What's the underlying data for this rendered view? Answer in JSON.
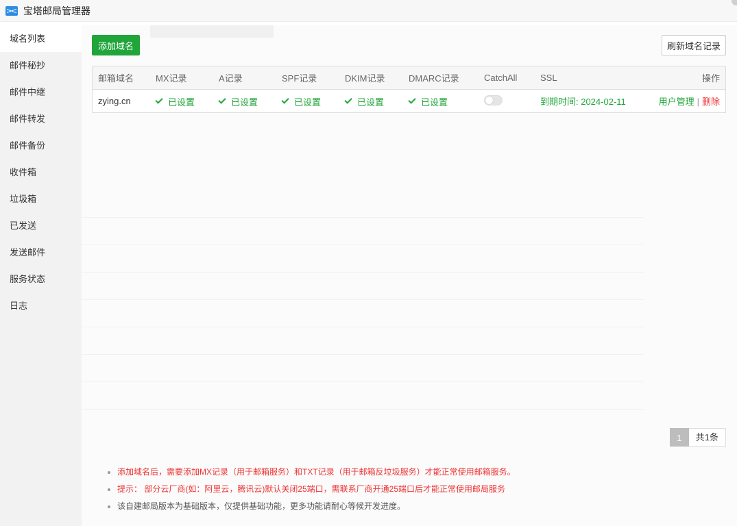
{
  "window": {
    "title": "宝塔邮局管理器"
  },
  "sidebar": {
    "items": [
      {
        "label": "域名列表",
        "active": true
      },
      {
        "label": "邮件秘抄"
      },
      {
        "label": "邮件中继"
      },
      {
        "label": "邮件转发"
      },
      {
        "label": "邮件备份"
      },
      {
        "label": "收件箱"
      },
      {
        "label": "垃圾箱"
      },
      {
        "label": "已发送"
      },
      {
        "label": "发送邮件"
      },
      {
        "label": "服务状态"
      },
      {
        "label": "日志"
      }
    ]
  },
  "toolbar": {
    "add_label": "添加域名",
    "refresh_label": "刷新域名记录"
  },
  "table": {
    "headers": {
      "domain": "邮箱域名",
      "mx": "MX记录",
      "a": "A记录",
      "spf": "SPF记录",
      "dkim": "DKIM记录",
      "dmarc": "DMARC记录",
      "catchall": "CatchAll",
      "ssl": "SSL",
      "op": "操作"
    },
    "rows": [
      {
        "domain": "zying.cn",
        "mx": "已设置",
        "a": "已设置",
        "spf": "已设置",
        "dkim": "已设置",
        "dmarc": "已设置",
        "catchall_on": false,
        "ssl": "到期时间: 2024-02-11",
        "op_users": "用户管理",
        "op_sep": "|",
        "op_delete": "删除"
      }
    ]
  },
  "pagination": {
    "current": "1",
    "total": "共1条"
  },
  "tips": [
    "添加域名后，需要添加MX记录（用于邮箱服务）和TXT记录（用于邮箱反垃圾服务）才能正常使用邮箱服务。",
    "提示： 部分云厂商(如：阿里云，腾讯云)默认关闭25端口，需联系厂商开通25端口后才能正常使用邮局服务",
    "该自建邮局版本为基础版本，仅提供基础功能，更多功能请耐心等候开发进度。"
  ],
  "colors": {
    "primary": "#20a53a",
    "danger": "#ee3333",
    "sidebar_bg": "#f2f2f2"
  },
  "icons": {
    "app": "mail-icon",
    "check": "check-icon"
  }
}
